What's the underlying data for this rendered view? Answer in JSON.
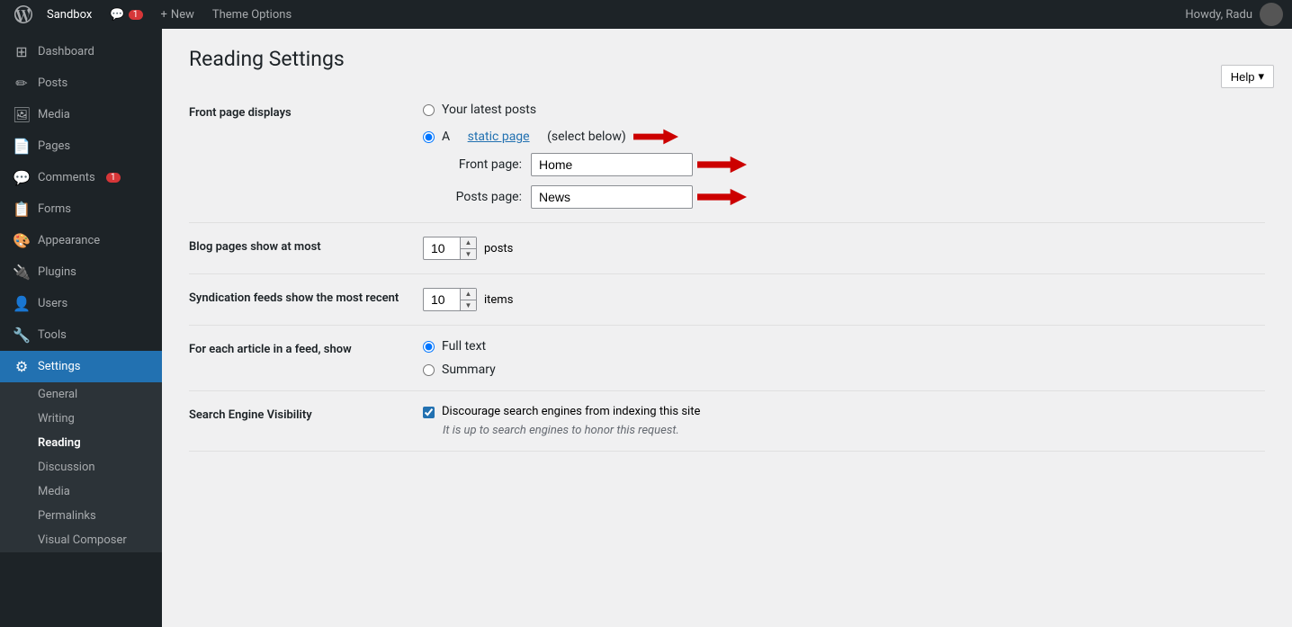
{
  "adminbar": {
    "logo_label": "WordPress",
    "site_name": "Sandbox",
    "comments_label": "1",
    "new_label": "New",
    "theme_options_label": "Theme Options",
    "howdy": "Howdy, Radu"
  },
  "help_button": "Help",
  "sidebar": {
    "items": [
      {
        "id": "dashboard",
        "label": "Dashboard",
        "icon": "⊞"
      },
      {
        "id": "posts",
        "label": "Posts",
        "icon": "📝"
      },
      {
        "id": "media",
        "label": "Media",
        "icon": "🖼"
      },
      {
        "id": "pages",
        "label": "Pages",
        "icon": "📄"
      },
      {
        "id": "comments",
        "label": "Comments",
        "icon": "💬",
        "badge": "1"
      },
      {
        "id": "forms",
        "label": "Forms",
        "icon": "📋"
      },
      {
        "id": "appearance",
        "label": "Appearance",
        "icon": "🎨"
      },
      {
        "id": "plugins",
        "label": "Plugins",
        "icon": "🔌"
      },
      {
        "id": "users",
        "label": "Users",
        "icon": "👤"
      },
      {
        "id": "tools",
        "label": "Tools",
        "icon": "🔧"
      },
      {
        "id": "settings",
        "label": "Settings",
        "icon": "⚙",
        "active": true
      }
    ],
    "settings_subitems": [
      {
        "id": "general",
        "label": "General"
      },
      {
        "id": "writing",
        "label": "Writing"
      },
      {
        "id": "reading",
        "label": "Reading",
        "active": true
      },
      {
        "id": "discussion",
        "label": "Discussion"
      },
      {
        "id": "media",
        "label": "Media"
      },
      {
        "id": "permalinks",
        "label": "Permalinks"
      },
      {
        "id": "visual-composer",
        "label": "Visual Composer"
      }
    ]
  },
  "page": {
    "title": "Reading Settings",
    "sections": {
      "front_page": {
        "label": "Front page displays",
        "option_latest": "Your latest posts",
        "option_static": "A",
        "static_page_link": "static page",
        "static_page_suffix": "(select below)",
        "front_page_label": "Front page:",
        "front_page_value": "Home",
        "posts_page_label": "Posts page:",
        "posts_page_value": "News"
      },
      "blog_pages": {
        "label": "Blog pages show at most",
        "value": "10",
        "suffix": "posts"
      },
      "syndication": {
        "label": "Syndication feeds show the most recent",
        "value": "10",
        "suffix": "items"
      },
      "feed_article": {
        "label": "For each article in a feed, show",
        "option_full": "Full text",
        "option_summary": "Summary"
      },
      "search_engine": {
        "label": "Search Engine Visibility",
        "checkbox_label": "Discourage search engines from indexing this site",
        "note": "It is up to search engines to honor this request."
      }
    }
  }
}
